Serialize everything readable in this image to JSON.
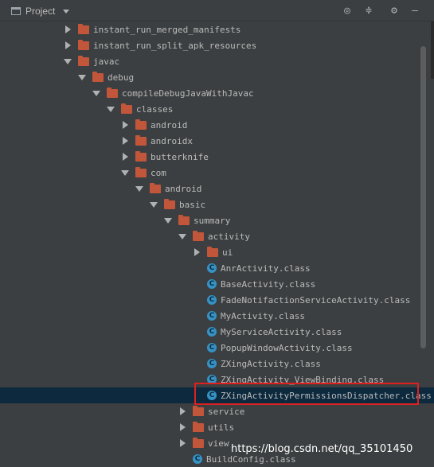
{
  "toolbar": {
    "title": "Project",
    "buttons": [
      {
        "name": "target-icon",
        "glyph": "◎"
      },
      {
        "name": "collapse-all-icon",
        "glyph": "≑"
      },
      {
        "name": "gear-icon",
        "glyph": "⚙"
      },
      {
        "name": "hide-icon",
        "glyph": "—"
      }
    ]
  },
  "tree": [
    {
      "label": "instant_run_merged_manifests",
      "depth": 0,
      "type": "folder",
      "arrow": "right"
    },
    {
      "label": "instant_run_split_apk_resources",
      "depth": 0,
      "type": "folder",
      "arrow": "right"
    },
    {
      "label": "javac",
      "depth": 0,
      "type": "folder",
      "arrow": "down"
    },
    {
      "label": "debug",
      "depth": 1,
      "type": "folder",
      "arrow": "down"
    },
    {
      "label": "compileDebugJavaWithJavac",
      "depth": 2,
      "type": "folder",
      "arrow": "down"
    },
    {
      "label": "classes",
      "depth": 3,
      "type": "folder",
      "arrow": "down"
    },
    {
      "label": "android",
      "depth": 4,
      "type": "folder",
      "arrow": "right"
    },
    {
      "label": "androidx",
      "depth": 4,
      "type": "folder",
      "arrow": "right"
    },
    {
      "label": "butterknife",
      "depth": 4,
      "type": "folder",
      "arrow": "right"
    },
    {
      "label": "com",
      "depth": 4,
      "type": "folder",
      "arrow": "down"
    },
    {
      "label": "android",
      "depth": 5,
      "type": "folder",
      "arrow": "down"
    },
    {
      "label": "basic",
      "depth": 6,
      "type": "folder",
      "arrow": "down"
    },
    {
      "label": "summary",
      "depth": 7,
      "type": "folder",
      "arrow": "down"
    },
    {
      "label": "activity",
      "depth": 8,
      "type": "folder",
      "arrow": "down"
    },
    {
      "label": "ui",
      "depth": 9,
      "type": "folder",
      "arrow": "right"
    },
    {
      "label": "AnrActivity.class",
      "depth": 9,
      "type": "class",
      "arrow": "none"
    },
    {
      "label": "BaseActivity.class",
      "depth": 9,
      "type": "class",
      "arrow": "none"
    },
    {
      "label": "FadeNotifactionServiceActivity.class",
      "depth": 9,
      "type": "class",
      "arrow": "none"
    },
    {
      "label": "MyActivity.class",
      "depth": 9,
      "type": "class",
      "arrow": "none"
    },
    {
      "label": "MyServiceActivity.class",
      "depth": 9,
      "type": "class",
      "arrow": "none"
    },
    {
      "label": "PopupWindowActivity.class",
      "depth": 9,
      "type": "class",
      "arrow": "none"
    },
    {
      "label": "ZXingActivity.class",
      "depth": 9,
      "type": "class",
      "arrow": "none"
    },
    {
      "label": "ZXingActivity_ViewBinding.class",
      "depth": 9,
      "type": "class",
      "arrow": "none"
    },
    {
      "label": "ZXingActivityPermissionsDispatcher.class",
      "depth": 9,
      "type": "class",
      "arrow": "none",
      "selected": true
    },
    {
      "label": "service",
      "depth": 8,
      "type": "folder",
      "arrow": "right"
    },
    {
      "label": "utils",
      "depth": 8,
      "type": "folder",
      "arrow": "right"
    },
    {
      "label": "view",
      "depth": 8,
      "type": "folder",
      "arrow": "right"
    },
    {
      "label": "BuildConfig.class",
      "depth": 8,
      "type": "class",
      "arrow": "none"
    }
  ],
  "watermark": "https://blog.csdn.net/qq_35101450"
}
